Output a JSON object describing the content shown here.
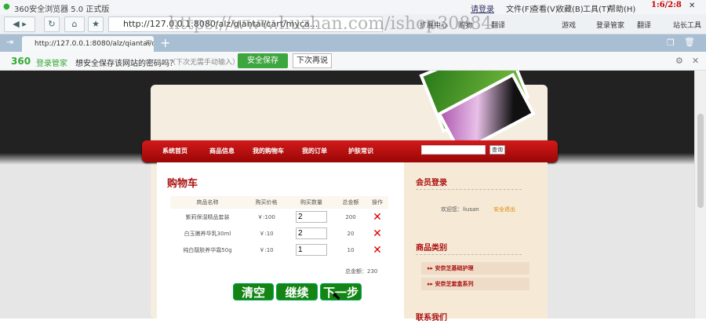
{
  "browser": {
    "title": "360安全浏览器 5.0 正式版",
    "login": "请登录",
    "menus": [
      "文件(F)",
      "查看(V)",
      "收藏(B)",
      "工具(T)",
      "帮助(H)"
    ],
    "url": "http://127.0.0.1:8080/alz/qiantai/cart/myca...",
    "tab_title": "http://127.0.0.1:8080/alz/qiantai/c...",
    "toolbar_items": [
      "扩展中心",
      "购物",
      "翻译",
      "游戏",
      "登录管家",
      "翻译",
      "站长工具"
    ],
    "watermark": "https://www.huzhan.com/ishop30884",
    "counter": "1:6/2:8"
  },
  "pwbar": {
    "brand": "360",
    "brand_sub": "登录管家",
    "question": "想安全保存该网站的密码吗？",
    "hint": "（下次无需手动输入）",
    "save": "安全保存",
    "later": "下次再说"
  },
  "nav": {
    "items": [
      "系统首页",
      "商品信息",
      "我的购物车",
      "我的订单",
      "护肤常识"
    ],
    "search_btn": "查询",
    "search_placeholder": ""
  },
  "cart": {
    "title": "购物车",
    "headers": [
      "商品名称",
      "购买价格",
      "购买数量",
      "总金额",
      "操作"
    ],
    "rows": [
      {
        "name": "紫莉保湿精品套装",
        "price": "￥:100",
        "qty": "2",
        "total": "200"
      },
      {
        "name": "白玉嫩养华乳30ml",
        "price": "￥:10",
        "qty": "2",
        "total": "20"
      },
      {
        "name": "纯白靓肤养华霜50g",
        "price": "￥:10",
        "qty": "1",
        "total": "10"
      }
    ],
    "grand_total": "总金额：230",
    "buttons": [
      "清空",
      "继续",
      "下一步"
    ]
  },
  "sidebar": {
    "login_title": "会员登录",
    "welcome": "欢迎您：liusan",
    "logout": "安全退出",
    "cat_title": "商品类别",
    "categories": [
      "安奈芝基础护理",
      "安奈芝套盒系列"
    ],
    "contact_title": "联系我们"
  }
}
